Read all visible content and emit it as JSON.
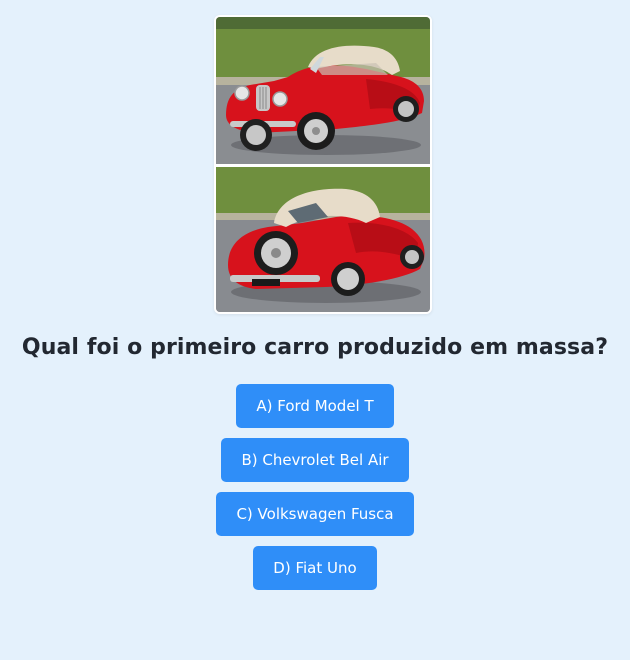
{
  "image": {
    "icon": "vintage-red-convertible-car-photo",
    "colors": {
      "car_body": "#d7121c",
      "soft_top": "#e7dcc9",
      "lawn": "#6a8a3a",
      "road": "#8c8f93"
    }
  },
  "quiz": {
    "question": "Qual foi o primeiro carro produzido em massa?",
    "answers": [
      {
        "label": "A) Ford Model T"
      },
      {
        "label": "B) Chevrolet Bel Air"
      },
      {
        "label": "C) Volkswagen Fusca"
      },
      {
        "label": "D) Fiat Uno"
      }
    ]
  },
  "colors": {
    "background": "#e4f1fc",
    "button": "#2f8ef8",
    "button_text": "#ffffff",
    "question_text": "#222831"
  }
}
